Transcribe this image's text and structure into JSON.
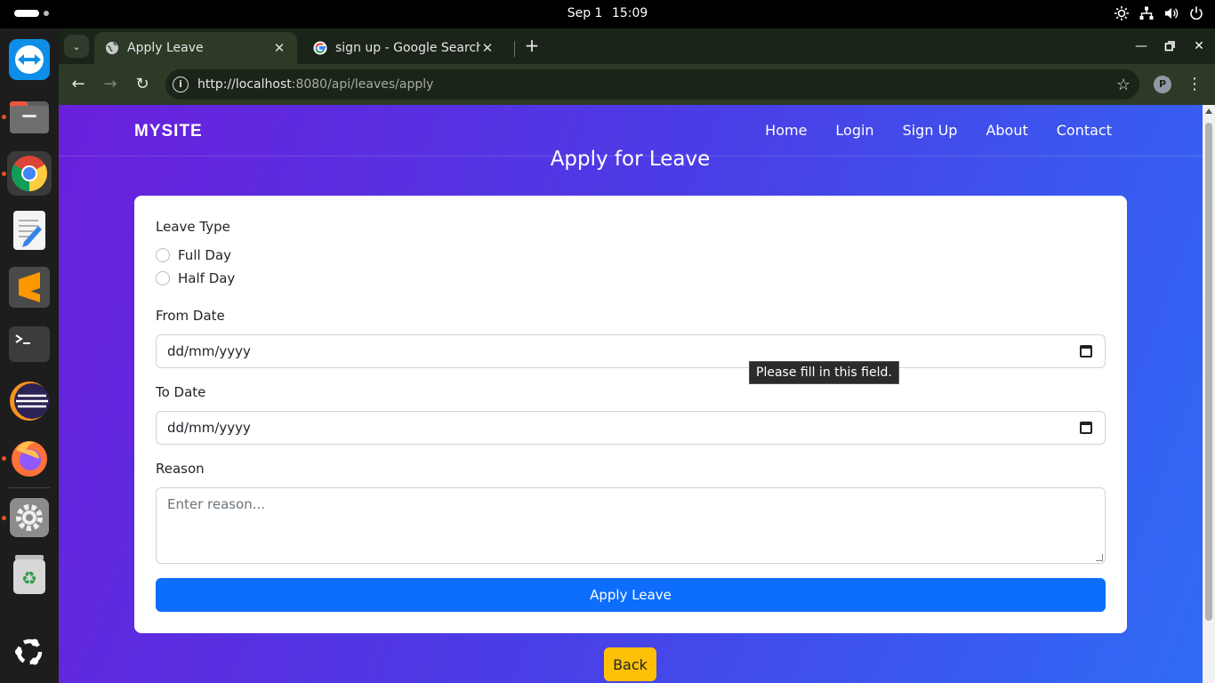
{
  "system": {
    "date": "Sep 1",
    "time": "15:09"
  },
  "dock": {
    "apps": [
      {
        "name": "TeamViewer",
        "icon": "teamviewer-icon"
      },
      {
        "name": "Files",
        "icon": "files-icon"
      },
      {
        "name": "Google Chrome",
        "icon": "chrome-icon"
      },
      {
        "name": "Text Editor",
        "icon": "text-editor-icon"
      },
      {
        "name": "Sublime Text",
        "icon": "sublime-text-icon"
      },
      {
        "name": "Terminal",
        "icon": "terminal-icon"
      },
      {
        "name": "Eclipse",
        "icon": "eclipse-icon"
      },
      {
        "name": "Firefox",
        "icon": "firefox-icon"
      },
      {
        "name": "Settings",
        "icon": "settings-icon"
      },
      {
        "name": "Trash",
        "icon": "trash-icon"
      },
      {
        "name": "Show Apps",
        "icon": "ubuntu-icon"
      }
    ]
  },
  "browser": {
    "tabs": [
      {
        "title": "Apply Leave",
        "active": true
      },
      {
        "title": "sign up - Google Search",
        "active": false
      }
    ],
    "url_host": "http://localhost",
    "url_rest": ":8080/api/leaves/apply",
    "profile_initial": "P"
  },
  "site": {
    "brand": "MYSITE",
    "nav": [
      "Home",
      "Login",
      "Sign Up",
      "About",
      "Contact"
    ]
  },
  "page": {
    "title": "Apply for Leave",
    "leave_type_label": "Leave Type",
    "options": [
      "Full Day",
      "Half Day"
    ],
    "from_date_label": "From Date",
    "from_date_value": "dd/mm/yyyy",
    "to_date_label": "To Date",
    "to_date_value": "dd/mm/yyyy",
    "reason_label": "Reason",
    "reason_placeholder": "Enter reason...",
    "submit_label": "Apply Leave",
    "back_label": "Back",
    "validation_tooltip": "Please fill in this field."
  },
  "colors": {
    "primary_button": "#0d6efd",
    "back_button": "#ffc107",
    "gradient_start": "#6a1fdb",
    "gradient_end": "#2f6bf5"
  }
}
